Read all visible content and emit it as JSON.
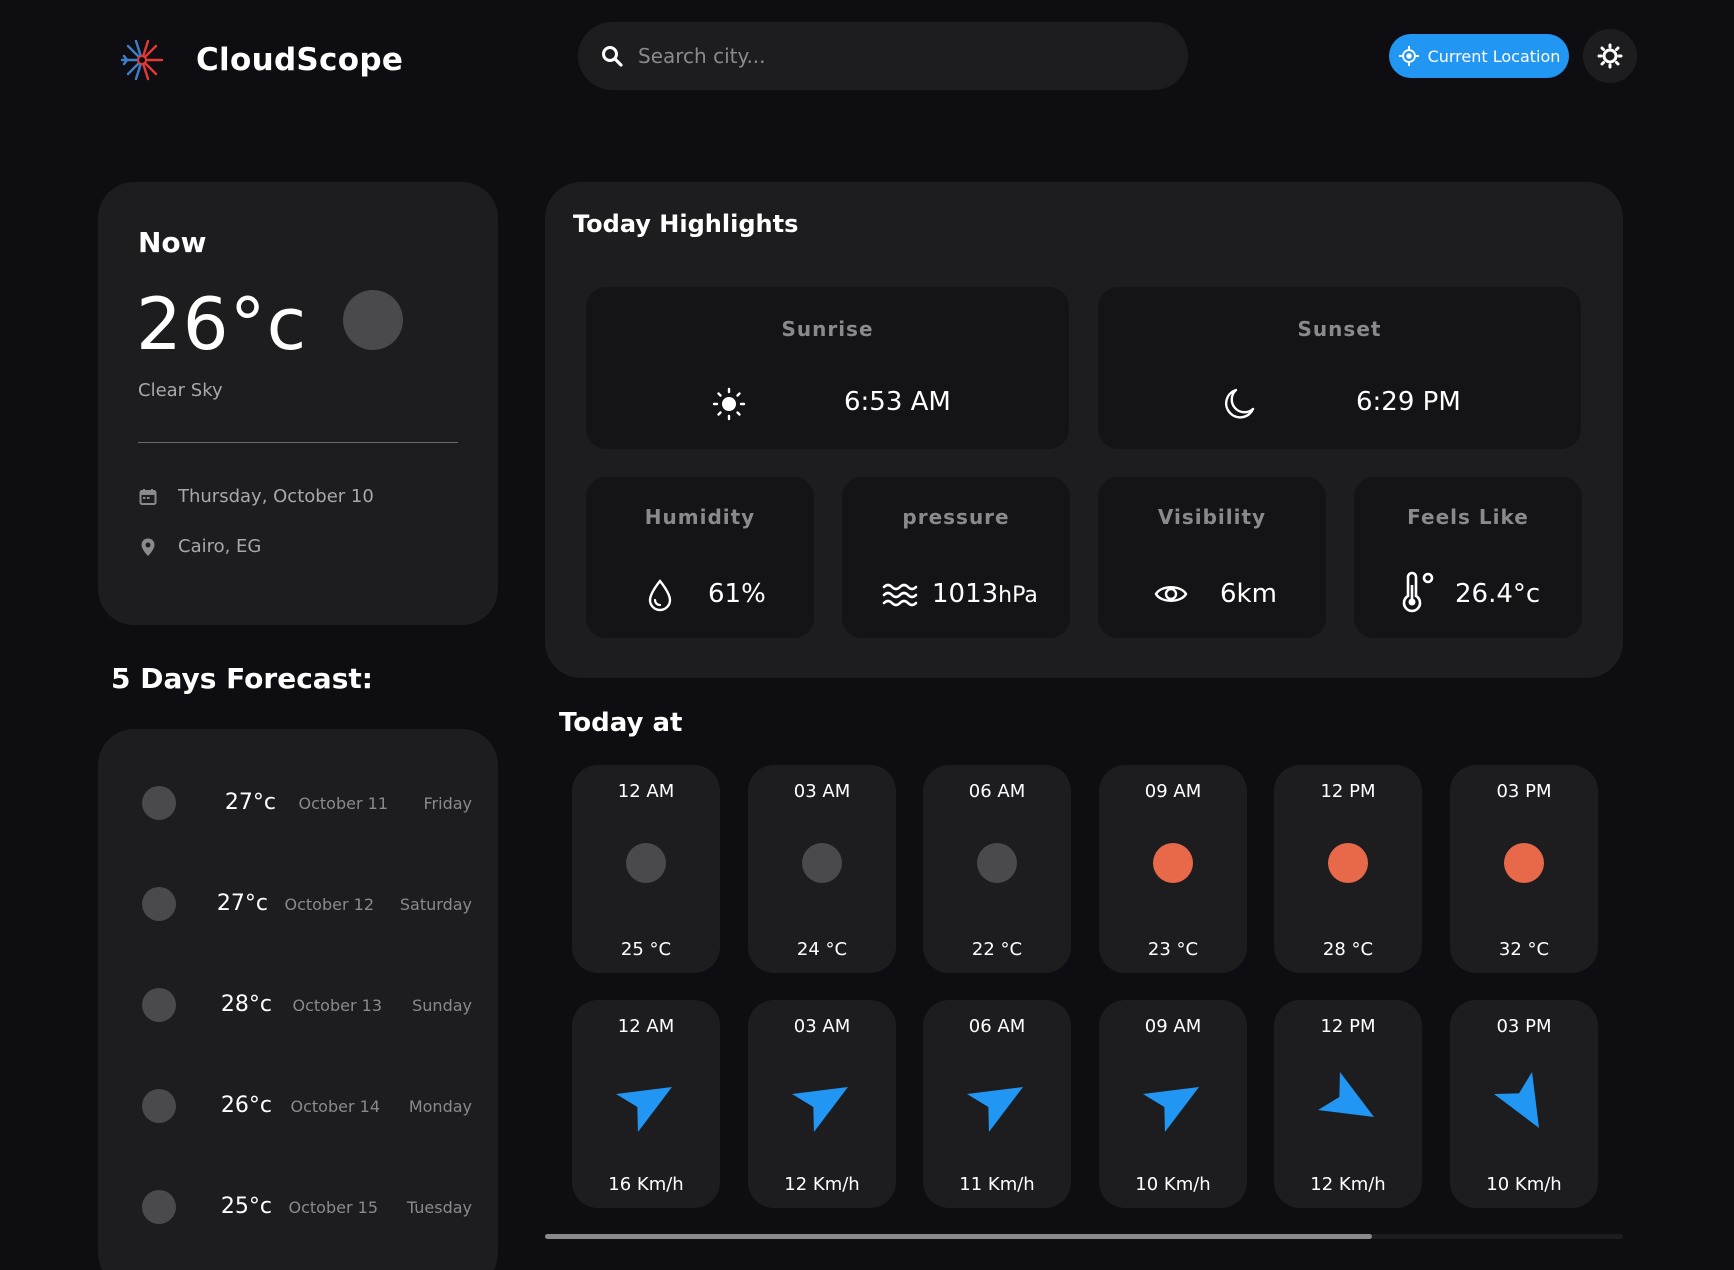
{
  "header": {
    "app_name": "CloudScope",
    "search_placeholder": "Search city...",
    "current_location_label": "Current Location"
  },
  "now": {
    "title": "Now",
    "temperature": "26°c",
    "description": "Clear Sky",
    "date": "Thursday, October 10",
    "location": "Cairo, EG"
  },
  "forecast": {
    "title": "5 Days Forecast:",
    "days": [
      {
        "temp": "27°c",
        "date": "October 11",
        "day": "Friday"
      },
      {
        "temp": "27°c",
        "date": "October 12",
        "day": "Saturday"
      },
      {
        "temp": "28°c",
        "date": "October 13",
        "day": "Sunday"
      },
      {
        "temp": "26°c",
        "date": "October 14",
        "day": "Monday"
      },
      {
        "temp": "25°c",
        "date": "October 15",
        "day": "Tuesday"
      }
    ]
  },
  "highlights": {
    "title": "Today Highlights",
    "sunrise": {
      "label": "Sunrise",
      "value": "6:53 AM"
    },
    "sunset": {
      "label": "Sunset",
      "value": "6:29 PM"
    },
    "humidity": {
      "label": "Humidity",
      "value": "61%"
    },
    "pressure": {
      "label": "pressure",
      "value": "1013",
      "unit": "hPa"
    },
    "visibility": {
      "label": "Visibility",
      "value": "6km"
    },
    "feels_like": {
      "label": "Feels Like",
      "value": "26.4°c"
    }
  },
  "today_at": {
    "title": "Today at",
    "hourly": [
      {
        "time": "12 AM",
        "temp": "25 °C",
        "icon_color": "#4a4a4d"
      },
      {
        "time": "03 AM",
        "temp": "24 °C",
        "icon_color": "#4a4a4d"
      },
      {
        "time": "06 AM",
        "temp": "22 °C",
        "icon_color": "#4a4a4d"
      },
      {
        "time": "09 AM",
        "temp": "23 °C",
        "icon_color": "#e8694a"
      },
      {
        "time": "12 PM",
        "temp": "28 °C",
        "icon_color": "#e8694a"
      },
      {
        "time": "03 PM",
        "temp": "32 °C",
        "icon_color": "#e8694a"
      }
    ],
    "wind": [
      {
        "time": "12 AM",
        "speed": "16 Km/h",
        "direction_deg": 60
      },
      {
        "time": "03 AM",
        "speed": "12 Km/h",
        "direction_deg": 60
      },
      {
        "time": "06 AM",
        "speed": "11 Km/h",
        "direction_deg": 60
      },
      {
        "time": "09 AM",
        "speed": "10 Km/h",
        "direction_deg": 60
      },
      {
        "time": "12 PM",
        "speed": "12 Km/h",
        "direction_deg": 120
      },
      {
        "time": "03 PM",
        "speed": "10 Km/h",
        "direction_deg": 150
      }
    ]
  },
  "colors": {
    "accent": "#2196f3",
    "background": "#0e0e12",
    "card": "#1d1d20"
  }
}
